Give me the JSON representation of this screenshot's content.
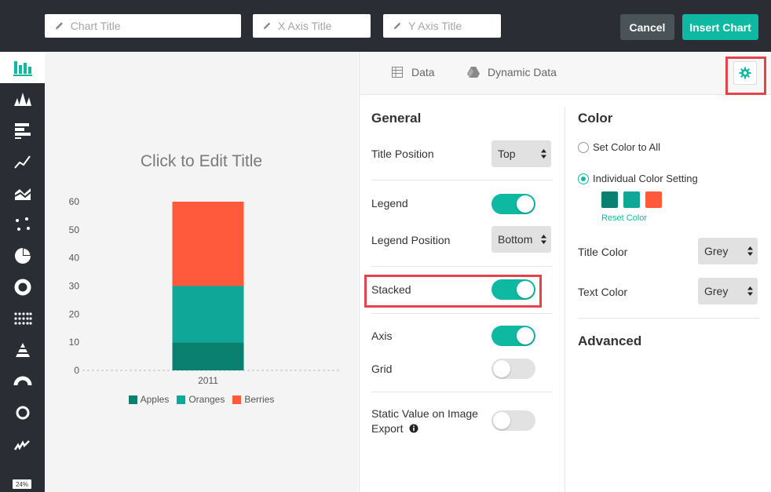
{
  "toolbar": {
    "chart_title_placeholder": "Chart Title",
    "x_axis_placeholder": "X Axis Title",
    "y_axis_placeholder": "Y Axis Title",
    "cancel_label": "Cancel",
    "insert_label": "Insert Chart"
  },
  "sidebar": {
    "items": [
      {
        "icon": "stacked-bar-chart-icon",
        "active": true
      },
      {
        "icon": "histogram-icon"
      },
      {
        "icon": "horizontal-bar-icon"
      },
      {
        "icon": "line-chart-icon"
      },
      {
        "icon": "area-chart-icon"
      },
      {
        "icon": "scatter-icon"
      },
      {
        "icon": "pie-chart-icon"
      },
      {
        "icon": "donut-chart-icon"
      },
      {
        "icon": "dot-matrix-icon"
      },
      {
        "icon": "pyramid-icon"
      },
      {
        "icon": "gauge-icon"
      },
      {
        "icon": "ring-icon"
      },
      {
        "icon": "sparkline-icon"
      }
    ],
    "zoom_badge": "24%"
  },
  "preview": {
    "title": "Click to Edit Title"
  },
  "chart_data": {
    "type": "bar",
    "stacked": true,
    "title": "Click to Edit Title",
    "categories": [
      "2011"
    ],
    "series": [
      {
        "name": "Apples",
        "values": [
          10
        ],
        "color": "#0a8070"
      },
      {
        "name": "Oranges",
        "values": [
          20
        ],
        "color": "#0fa898"
      },
      {
        "name": "Berries",
        "values": [
          30
        ],
        "color": "#ff5a3c"
      }
    ],
    "yticks": [
      0,
      10,
      20,
      30,
      40,
      50,
      60
    ],
    "ylim": [
      0,
      60
    ],
    "legend": "bottom"
  },
  "tabs": {
    "data_label": "Data",
    "dynamic_label": "Dynamic Data"
  },
  "general": {
    "title": "General",
    "title_position_label": "Title Position",
    "title_position_value": "Top",
    "legend_label": "Legend",
    "legend_on": true,
    "legend_position_label": "Legend Position",
    "legend_position_value": "Bottom",
    "stacked_label": "Stacked",
    "stacked_on": true,
    "axis_label": "Axis",
    "axis_on": true,
    "grid_label": "Grid",
    "grid_on": false,
    "static_label_line1": "Static Value on Image",
    "static_label_line2": "Export",
    "static_on": false
  },
  "color": {
    "title": "Color",
    "set_all_label": "Set Color to All",
    "individual_label": "Individual Color Setting",
    "swatches": [
      "#0a8070",
      "#0fa898",
      "#ff5a3c"
    ],
    "reset_label": "Reset Color",
    "title_color_label": "Title Color",
    "title_color_value": "Grey",
    "text_color_label": "Text Color",
    "text_color_value": "Grey"
  },
  "advanced": {
    "title": "Advanced"
  },
  "colors": {
    "accent": "#0fb9a1",
    "dark": "#2b2d35",
    "highlight": "#e5434b"
  }
}
